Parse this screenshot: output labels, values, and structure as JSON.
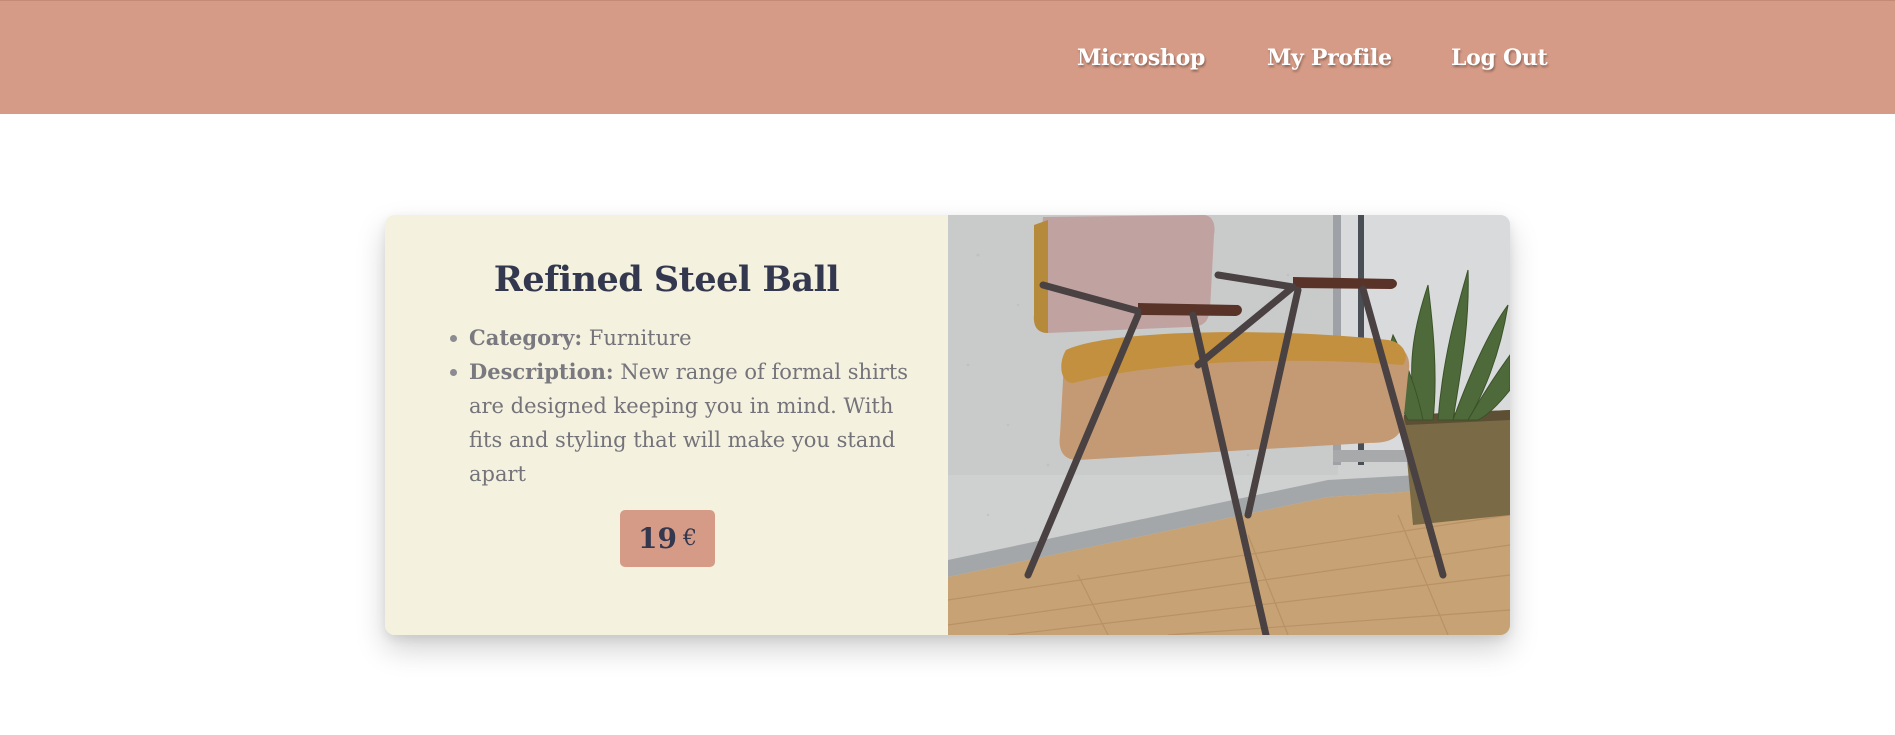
{
  "nav": {
    "links": [
      "Microshop",
      "My Profile",
      "Log Out"
    ]
  },
  "product": {
    "title": "Refined Steel Ball",
    "category_label": "Category:",
    "category": "Furniture",
    "description_label": "Description:",
    "description": "New range of formal shirts are designed keeping you in mind. With fits and styling that will make you stand apart",
    "price": "19",
    "currency": "€",
    "image_subject": "mid-century armchair with potted plant"
  },
  "colors": {
    "navbar": "#d69b86",
    "card_info_bg": "#f4f1df",
    "title_text": "#33384f",
    "body_text": "#74737a",
    "price_badge": "#d69b86"
  }
}
